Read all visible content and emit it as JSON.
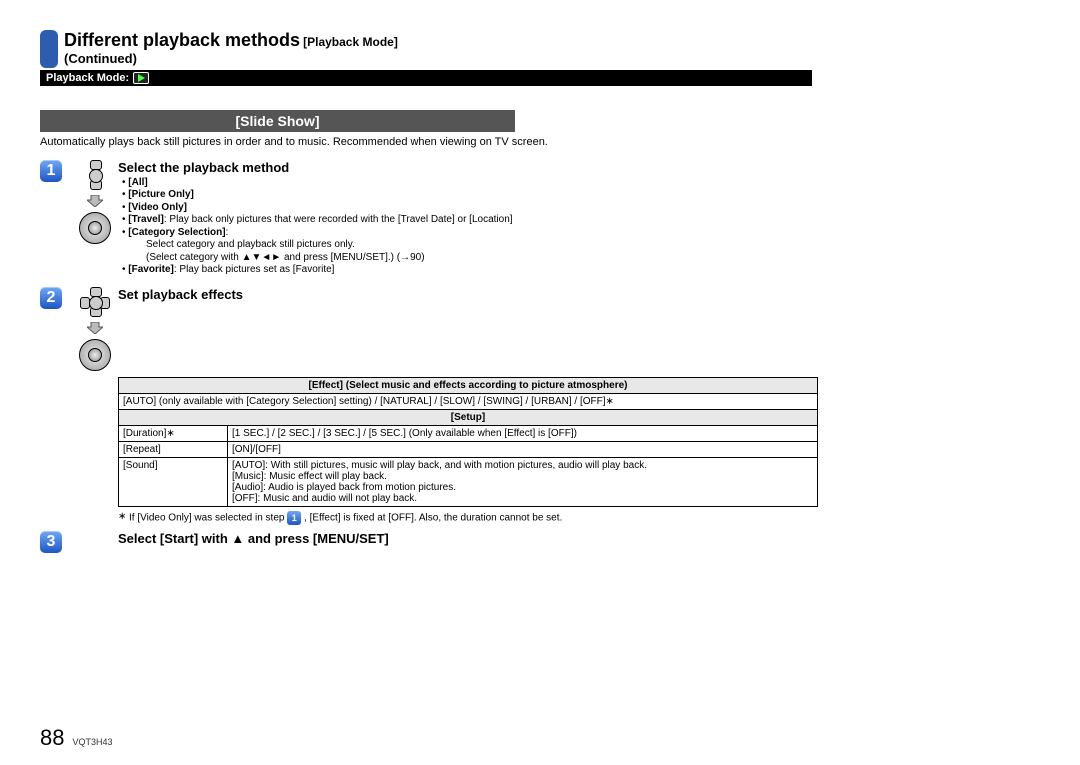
{
  "header": {
    "title_main": "Different playback methods",
    "title_sub": "[Playback Mode]",
    "continued": "(Continued)",
    "mode_label": "Playback Mode:"
  },
  "section": {
    "title": "[Slide Show]",
    "intro": "Automatically plays back still pictures in order and to music. Recommended when viewing on TV screen."
  },
  "step1": {
    "num": "1",
    "heading": "Select the playback method",
    "opt_all": "[All]",
    "opt_picture": "[Picture Only]",
    "opt_video": "[Video Only]",
    "opt_travel_label": "[Travel]",
    "opt_travel_desc": ": Play back only pictures that were recorded with the [Travel Date] or [Location]",
    "opt_category_label": "[Category Selection]",
    "opt_category_desc_l1": "Select category and playback still pictures only.",
    "opt_category_desc_l2": "(Select category with ▲▼◄► and press [MENU/SET].) (→90)",
    "opt_favorite_label": "[Favorite]",
    "opt_favorite_desc": ": Play back pictures set as [Favorite]"
  },
  "step2": {
    "num": "2",
    "heading": "Set playback effects"
  },
  "table": {
    "header_effect": "[Effect] (Select music and effects according to picture atmosphere)",
    "row_effect": "[AUTO] (only available with [Category Selection] setting) / [NATURAL] / [SLOW] / [SWING] / [URBAN] / [OFF]∗",
    "header_setup": "[Setup]",
    "duration_label": "[Duration]∗",
    "duration_val": "[1 SEC.] / [2 SEC.] / [3 SEC.] / [5 SEC.] (Only available when [Effect] is [OFF])",
    "repeat_label": "[Repeat]",
    "repeat_val": "[ON]/[OFF]",
    "sound_label": "[Sound]",
    "sound_val": "[AUTO]: With still pictures, music will play back, and with motion pictures, audio will play back.\n[Music]: Music effect will play back.\n[Audio]: Audio is played back from motion pictures.\n[OFF]: Music and audio will not play back."
  },
  "footnote": {
    "mark": "∗",
    "text_before": "If [Video Only] was selected in step ",
    "badge": "1",
    "text_after": ", [Effect] is fixed at [OFF]. Also, the duration cannot be set."
  },
  "step3": {
    "num": "3",
    "heading": "Select [Start] with ▲ and press [MENU/SET]"
  },
  "footer": {
    "page": "88",
    "code": "VQT3H43"
  }
}
